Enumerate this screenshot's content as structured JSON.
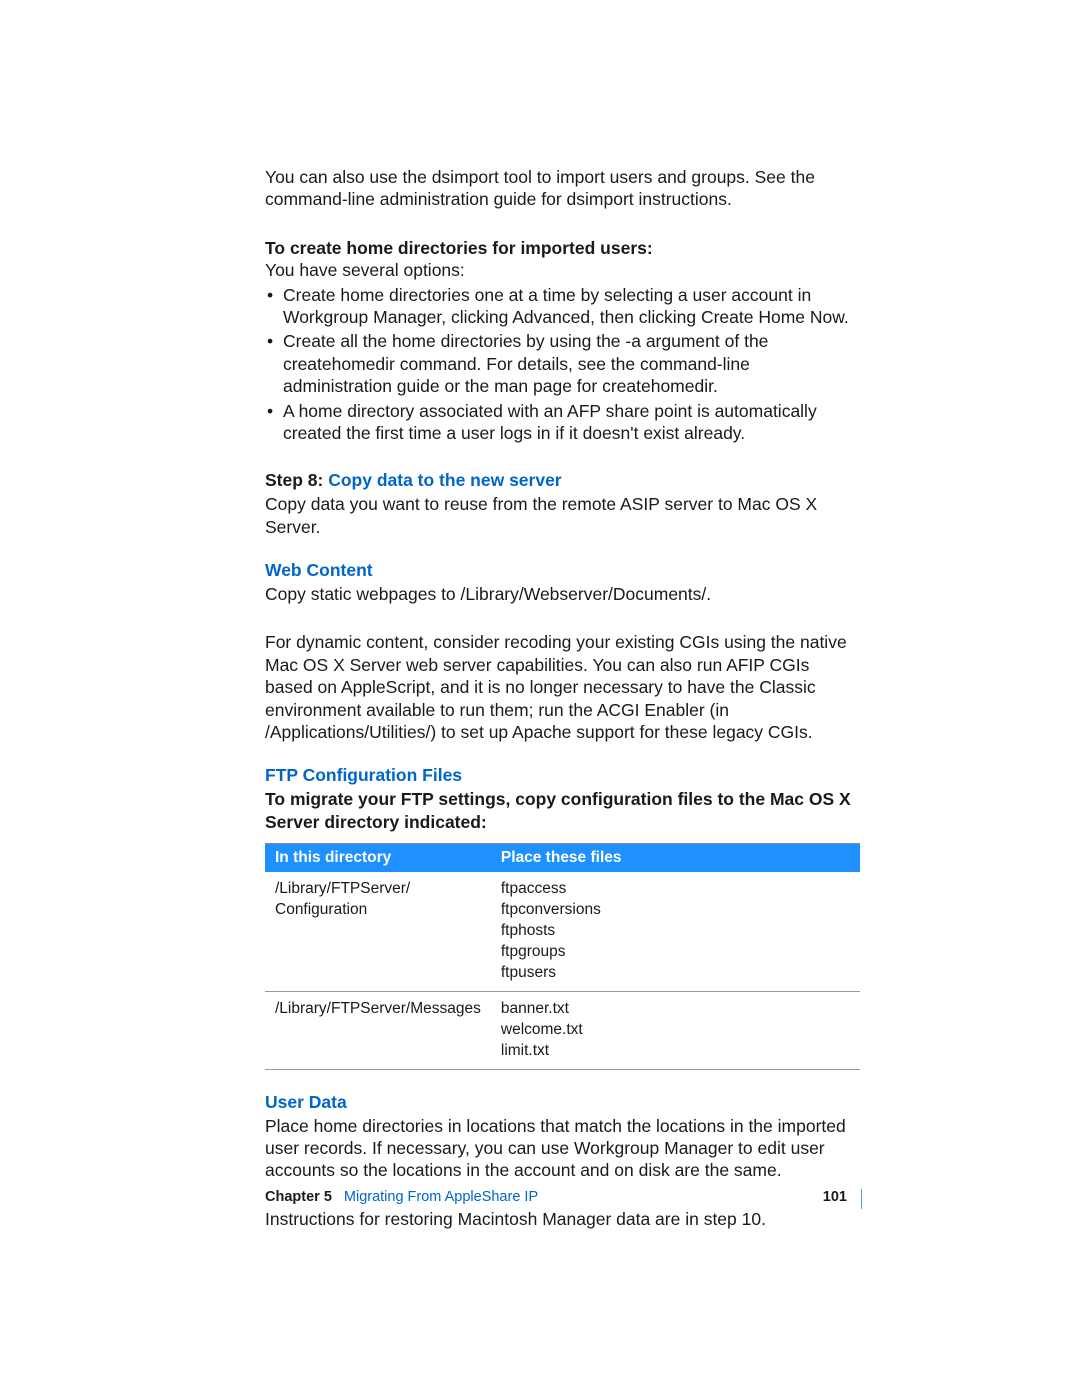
{
  "intro": "You can also use the dsimport tool to import users and groups. See the command-line administration guide for dsimport instructions.",
  "homeDirs": {
    "heading": "To create home directories for imported users:",
    "lead": "You have several options:",
    "bullets": [
      "Create home directories one at a time by selecting a user account in Workgroup Manager, clicking Advanced, then clicking Create Home Now.",
      "Create all the home directories by using the -a argument of the createhomedir command. For details, see the command-line administration guide or the man page for createhomedir.",
      "A home directory associated with an AFP share point is automatically created the first time a user logs in if it doesn't exist already."
    ]
  },
  "step8": {
    "label": "Step 8:  ",
    "title": "Copy data to the new server",
    "body": "Copy data you want to reuse from the remote ASIP server to Mac OS X Server."
  },
  "webContent": {
    "heading": "Web Content",
    "p1": "Copy static webpages to /Library/Webserver/Documents/.",
    "p2": "For dynamic content, consider recoding your existing CGIs using the native Mac OS X Server web server capabilities. You can also run AFIP CGIs based on AppleScript, and it is no longer necessary to have the Classic environment available to run them; run the ACGI Enabler (in /Applications/Utilities/) to set up Apache support for these legacy CGIs."
  },
  "ftp": {
    "heading": "FTP Configuration Files",
    "lead": "To migrate your FTP settings, copy configuration files to the Mac OS X Server directory indicated:",
    "columns": [
      "In this directory",
      "Place these files"
    ],
    "rows": [
      {
        "dir": "/Library/FTPServer/\nConfiguration",
        "files": "ftpaccess\nftpconversions\nftphosts\nftpgroups\nftpusers"
      },
      {
        "dir": "/Library/FTPServer/Messages",
        "files": "banner.txt\nwelcome.txt\nlimit.txt"
      }
    ]
  },
  "userData": {
    "heading": "User Data",
    "p1": "Place home directories in locations that match the locations in the imported user records. If necessary, you can use Workgroup Manager to edit user accounts so the locations in the account and on disk are the same.",
    "p2": "Instructions for restoring Macintosh Manager data are in step 10."
  },
  "footer": {
    "chapter": "Chapter 5",
    "title": "Migrating From AppleShare IP",
    "page": "101"
  }
}
